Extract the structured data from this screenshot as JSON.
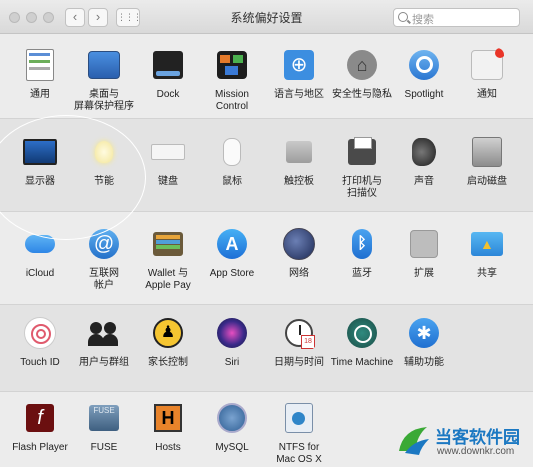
{
  "window": {
    "title": "系统偏好设置"
  },
  "search": {
    "placeholder": "搜索"
  },
  "nav": {
    "back": "‹",
    "forward": "›",
    "grid": "⋮⋮⋮"
  },
  "rows": [
    [
      {
        "id": "general",
        "label": "通用",
        "icon": "general-icon"
      },
      {
        "id": "desktop",
        "label": "桌面与\n屏幕保护程序",
        "icon": "desktop-icon"
      },
      {
        "id": "dock",
        "label": "Dock",
        "icon": "dock-icon"
      },
      {
        "id": "mission",
        "label": "Mission\nControl",
        "icon": "mission-control-icon"
      },
      {
        "id": "language",
        "label": "语言与地区",
        "icon": "language-region-icon"
      },
      {
        "id": "security",
        "label": "安全性与隐私",
        "icon": "security-lock-icon"
      },
      {
        "id": "spotlight",
        "label": "Spotlight",
        "icon": "spotlight-icon"
      },
      {
        "id": "notifications",
        "label": "通知",
        "icon": "notifications-icon"
      }
    ],
    [
      {
        "id": "displays",
        "label": "显示器",
        "icon": "display-icon"
      },
      {
        "id": "energy",
        "label": "节能",
        "icon": "lightbulb-icon"
      },
      {
        "id": "keyboard",
        "label": "键盘",
        "icon": "keyboard-icon"
      },
      {
        "id": "mouse",
        "label": "鼠标",
        "icon": "mouse-icon"
      },
      {
        "id": "trackpad",
        "label": "触控板",
        "icon": "trackpad-icon"
      },
      {
        "id": "printers",
        "label": "打印机与\n扫描仪",
        "icon": "printer-icon"
      },
      {
        "id": "sound",
        "label": "声音",
        "icon": "speaker-icon"
      },
      {
        "id": "startup",
        "label": "启动磁盘",
        "icon": "startup-disk-icon"
      }
    ],
    [
      {
        "id": "icloud",
        "label": "iCloud",
        "icon": "icloud-icon"
      },
      {
        "id": "internet",
        "label": "互联网\n帐户",
        "icon": "internet-accounts-icon"
      },
      {
        "id": "wallet",
        "label": "Wallet 与\nApple Pay",
        "icon": "wallet-icon"
      },
      {
        "id": "appstore",
        "label": "App Store",
        "icon": "app-store-icon"
      },
      {
        "id": "network",
        "label": "网络",
        "icon": "network-globe-icon"
      },
      {
        "id": "bluetooth",
        "label": "蓝牙",
        "icon": "bluetooth-icon"
      },
      {
        "id": "extensions",
        "label": "扩展",
        "icon": "extensions-puzzle-icon"
      },
      {
        "id": "sharing",
        "label": "共享",
        "icon": "sharing-folder-icon"
      }
    ],
    [
      {
        "id": "touchid",
        "label": "Touch ID",
        "icon": "fingerprint-icon"
      },
      {
        "id": "users",
        "label": "用户与群组",
        "icon": "users-icon"
      },
      {
        "id": "parental",
        "label": "家长控制",
        "icon": "parental-controls-icon"
      },
      {
        "id": "siri",
        "label": "Siri",
        "icon": "siri-icon"
      },
      {
        "id": "datetime",
        "label": "日期与时间",
        "icon": "clock-calendar-icon"
      },
      {
        "id": "timemachine",
        "label": "Time Machine",
        "icon": "time-machine-icon"
      },
      {
        "id": "accessibility",
        "label": "辅助功能",
        "icon": "accessibility-icon"
      }
    ],
    [
      {
        "id": "flash",
        "label": "Flash Player",
        "icon": "flash-player-icon"
      },
      {
        "id": "fuse",
        "label": "FUSE",
        "icon": "fuse-icon"
      },
      {
        "id": "hosts",
        "label": "Hosts",
        "icon": "hosts-icon"
      },
      {
        "id": "mysql",
        "label": "MySQL",
        "icon": "mysql-icon"
      },
      {
        "id": "ntfs",
        "label": "NTFS for\nMac OS X",
        "icon": "ntfs-icon"
      }
    ]
  ],
  "watermark": {
    "name": "当客软件园",
    "url": "www.downkr.com"
  }
}
